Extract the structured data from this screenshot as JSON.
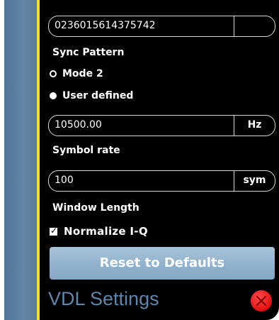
{
  "sync_pattern": {
    "value": "0236015614375742",
    "unit": "",
    "label": "Sync Pattern"
  },
  "mode_options": [
    {
      "label": "Mode 2",
      "selected": false
    },
    {
      "label": "User defined",
      "selected": true
    }
  ],
  "symbol_rate": {
    "value": "10500.00",
    "unit": "Hz",
    "label": "Symbol rate"
  },
  "window_length": {
    "value": "100",
    "unit": "sym",
    "label": "Window Length"
  },
  "normalize": {
    "label": "Normalize I-Q",
    "checked": true
  },
  "reset_button": {
    "label": "Reset to Defaults"
  },
  "footer": {
    "title": "VDL Settings",
    "close_icon": "close-icon"
  },
  "colors": {
    "panel_bg": "#000000",
    "side_tab": "#5e82a3",
    "side_edge": "#f4e21a",
    "button": "#9ab8d2",
    "title": "#5e86ad",
    "close": "#e01010"
  }
}
